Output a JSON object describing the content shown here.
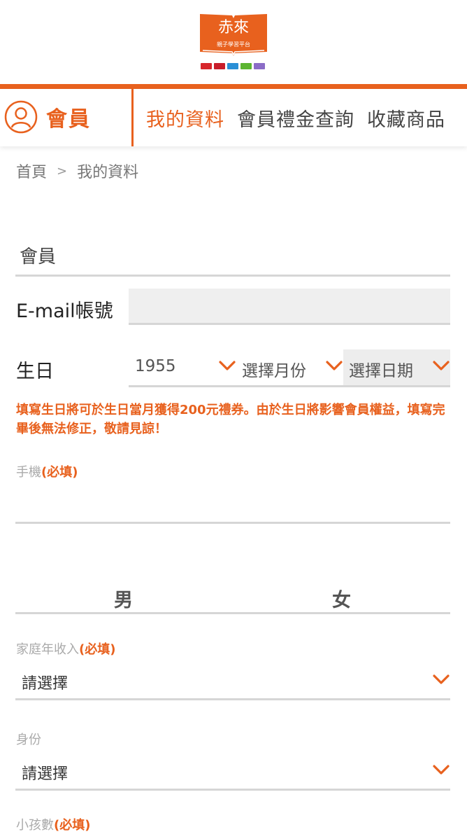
{
  "brand": {
    "logo_text": "赤來",
    "logo_subtext": "親子學習平台",
    "strip_colors": [
      "#d7262b",
      "#c81d2a",
      "#2a8fd6",
      "#5cb531",
      "#8b6cc7"
    ],
    "accent": "#e8611e"
  },
  "nav": {
    "member_label": "會員",
    "tabs": [
      {
        "label": "我的資料",
        "active": true
      },
      {
        "label": "會員禮金查詢",
        "active": false
      },
      {
        "label": "收藏商品",
        "active": false
      }
    ]
  },
  "breadcrumb": {
    "home": "首頁",
    "separator": ">",
    "current": "我的資料"
  },
  "form": {
    "section_title": "會員",
    "email_label": "E-mail帳號",
    "email_value": "",
    "birthday_label": "生日",
    "birthday_year": "1955",
    "birthday_month_placeholder": "選擇月份",
    "birthday_day_placeholder": "選擇日期",
    "birthday_notice": "填寫生日將可於生日當月獲得200元禮券。由於生日將影響會員權益，填寫完畢後無法修正，敬請見諒！",
    "phone_label": "手機",
    "phone_required": "(必填)",
    "phone_value": "",
    "gender_male": "男",
    "gender_female": "女",
    "income_label": "家庭年收入",
    "income_required": "(必填)",
    "income_value": "請選擇",
    "identity_label": "身份",
    "identity_value": "請選擇",
    "children_label": "小孩數",
    "children_required": "(必填)"
  }
}
